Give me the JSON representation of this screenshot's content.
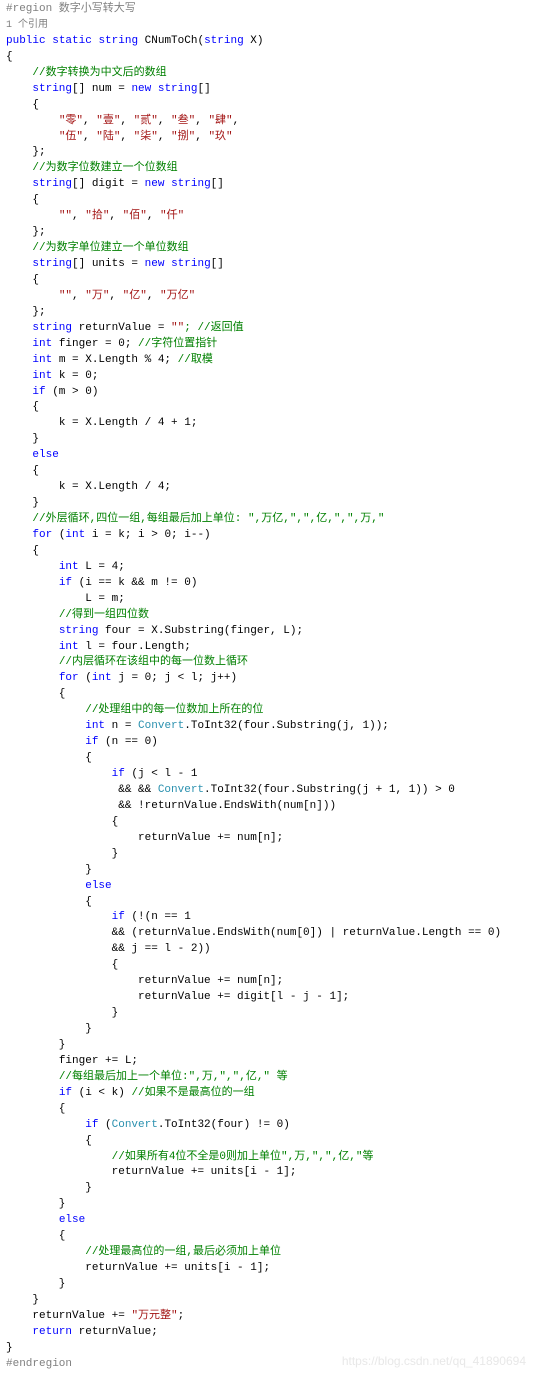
{
  "region_start": "#region 数字小写转大写",
  "ref_text": "1 个引用",
  "sig_pub": "public",
  "sig_static": "static",
  "sig_string": "string",
  "sig_method": " CNumToCh(",
  "sig_param": " X)",
  "open_brace": "{",
  "close_brace": "}",
  "c_num_comment": "//数字转换为中文后的数组",
  "arr_decl": "[] num = ",
  "new_kw": "new",
  "arr_suffix": "[]",
  "num_line1a": "\"零\"",
  "num_line1b": "\"壹\"",
  "num_line1c": "\"贰\"",
  "num_line1d": "\"叁\"",
  "num_line1e": "\"肆\"",
  "num_line2a": "\"伍\"",
  "num_line2b": "\"陆\"",
  "num_line2c": "\"柒\"",
  "num_line2d": "\"捌\"",
  "num_line2e": "\"玖\"",
  "c_digit_comment": "//为数字位数建立一个位数组",
  "digit_decl": "[] digit = ",
  "digit_a": "\"\"",
  "digit_b": "\"拾\"",
  "digit_c": "\"佰\"",
  "digit_d": "\"仟\"",
  "c_units_comment": "//为数字单位建立一个单位数组",
  "units_decl": "[] units = ",
  "units_a": "\"\"",
  "units_b": "\"万\"",
  "units_c": "\"亿\"",
  "units_d": "\"万亿\"",
  "rv_decl": " returnValue = ",
  "rv_empty": "\"\"",
  "rv_comment": "; //返回值",
  "finger_decl": " finger = 0; ",
  "finger_comment": "//字符位置指针",
  "m_decl": " m = X.Length % 4; ",
  "m_comment": "//取模",
  "k_decl": " k = 0;",
  "if_m": " (m > 0)",
  "k_assign1": "k = X.Length / 4 + 1;",
  "else_kw": "else",
  "k_assign2": "k = X.Length / 4;",
  "outer_comment": "//外层循环,四位一组,每组最后加上单位: \",万亿,\",\",亿,\",\",万,\"",
  "for_kw": "for",
  "for_outer": " i = k; i > 0; i--)",
  "l_decl": " L = 4;",
  "if_ik": " (i == k && m != 0)",
  "l_assign": "L = m;",
  "four_comment": "//得到一组四位数",
  "four_decl": " four = X.Substring(finger, L);",
  "l2_decl": " l = four.Length;",
  "inner_comment": "//内层循环在该组中的每一位数上循环",
  "for_inner": " j = 0; j < l; j++)",
  "proc_comment": "//处理组中的每一位数加上所在的位",
  "n_decl": " n = ",
  "convert": "Convert",
  "toint32": ".ToInt32(four.Substring(j, 1));",
  "if_n0": " (n == 0)",
  "if_jl": " (j < l - 1",
  "and_conv": " && ",
  "conv2": ".ToInt32(four.Substring(j + 1, 1)) > 0",
  "and_rv": " && !returnValue.EndsWith(num[n]))",
  "rv_add_num": "returnValue += num[n];",
  "if_not_n1": " (!(n == 1",
  "and_rv2": "&& (returnValue.EndsWith(num[0]) | returnValue.Length == 0)",
  "and_j": "&& j == l - 2))",
  "rv_add_digit": "returnValue += digit[l - j - 1];",
  "finger_add": "finger += L;",
  "group_comment": "//每组最后加上一个单位:\",万,\",\",亿,\" 等",
  "if_ik2": " (i < k) ",
  "group_comment2": "//如果不是最高位的一组",
  "if_conv4": " (",
  "conv4": ".ToInt32(four) != 0)",
  "four0_comment": "//如果所有4位不全是0则加上单位\",万,\",\",亿,\"等",
  "rv_add_units": "returnValue += units[i - 1];",
  "high_comment": "//处理最高位的一组,最后必须加上单位",
  "rv_final": "returnValue += ",
  "wanyuan": "\"万元整\"",
  "return_kw": "return",
  "return_rv": " returnValue;",
  "region_end": "#endregion",
  "watermark": "https://blog.csdn.net/qq_41890694",
  "int_kw": "int",
  "if_kw": "if",
  "comma": ", ",
  "semi": ";",
  "lparen": " (",
  "rparen": ")"
}
